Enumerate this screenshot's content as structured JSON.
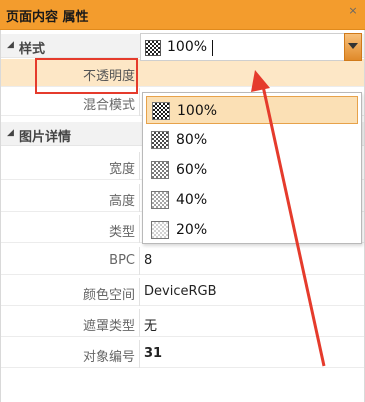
{
  "window": {
    "title": "页面内容 属性",
    "close_glyph": "×"
  },
  "sections": {
    "style": {
      "label": "样式",
      "toggle_glyph": "◢"
    },
    "image": {
      "label": "图片详情",
      "toggle_glyph": "◢"
    }
  },
  "properties": {
    "opacity": {
      "label": "不透明度",
      "value": "100%"
    },
    "blend": {
      "label": "混合模式"
    },
    "width": {
      "label": "宽度"
    },
    "height": {
      "label": "高度"
    },
    "type": {
      "label": "类型"
    },
    "bpc": {
      "label": "BPC",
      "value": "8"
    },
    "colorspace": {
      "label": "颜色空间",
      "value": "DeviceRGB"
    },
    "mask": {
      "label": "遮罩类型",
      "value": "无"
    },
    "objid": {
      "label": "对象编号",
      "value": "31"
    }
  },
  "opacity_dropdown": {
    "selected": "100%",
    "options": [
      "100%",
      "80%",
      "60%",
      "40%",
      "20%"
    ]
  },
  "colors": {
    "title_bar": "#f39c2d",
    "highlight_box": "#e53b2c",
    "arrow": "#e53b2c",
    "selected_item": "#fbe0b5"
  }
}
